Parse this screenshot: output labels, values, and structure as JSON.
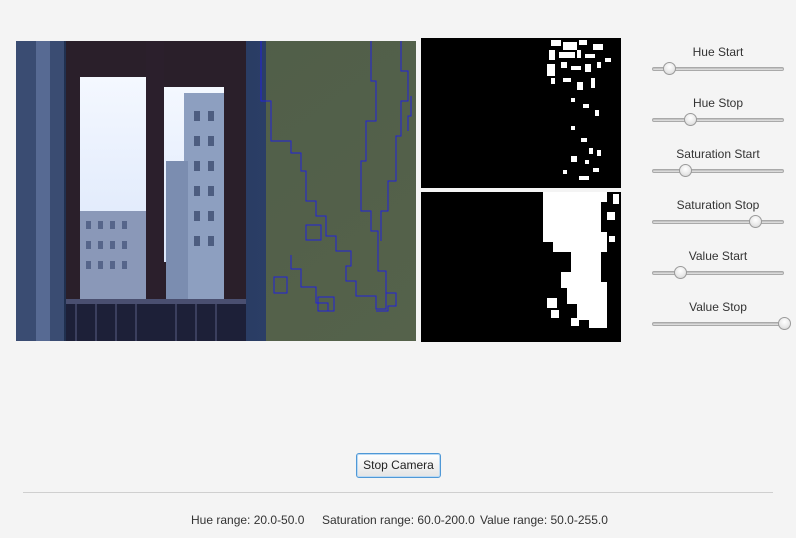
{
  "sliders": [
    {
      "label": "Hue Start",
      "value_fraction": 0.13
    },
    {
      "label": "Hue Stop",
      "value_fraction": 0.29
    },
    {
      "label": "Saturation Start",
      "value_fraction": 0.25
    },
    {
      "label": "Saturation Stop",
      "value_fraction": 0.78
    },
    {
      "label": "Value Start",
      "value_fraction": 0.21
    },
    {
      "label": "Value Stop",
      "value_fraction": 1.0
    }
  ],
  "controls": {
    "stop_camera_label": "Stop Camera"
  },
  "status": {
    "hue_range": "Hue range: 20.0-50.0",
    "saturation_range": "Saturation range: 60.0-200.0",
    "value_range": "Value range: 50.0-255.0"
  },
  "colors": {
    "contour": "#2323d8",
    "button_focus": "#4f98d6"
  }
}
